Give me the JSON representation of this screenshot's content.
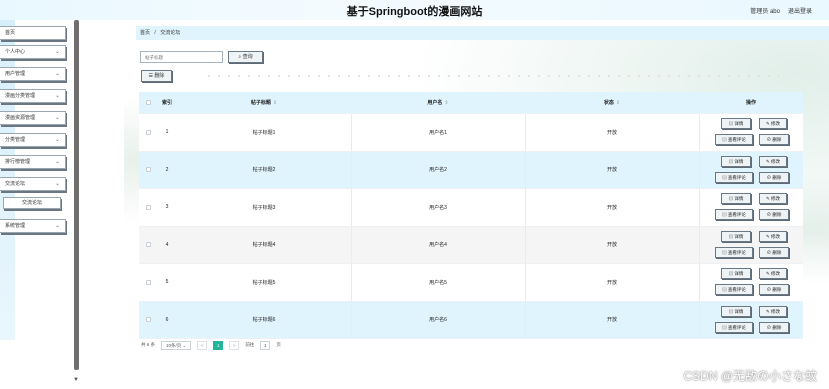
{
  "header": {
    "title": "基于Springboot的漫画网站",
    "user_label": "管理员 abo",
    "logout": "退出登录"
  },
  "sidebar": {
    "items": [
      {
        "label": "首页",
        "has_chevron": false
      },
      {
        "label": "个人中心",
        "has_chevron": true
      },
      {
        "label": "用户管理",
        "has_chevron": true
      },
      {
        "label": "漫画分类管理",
        "has_chevron": true
      },
      {
        "label": "漫画资源管理",
        "has_chevron": true
      },
      {
        "label": "分类管理",
        "has_chevron": true
      },
      {
        "label": "排行榜管理",
        "has_chevron": true
      },
      {
        "label": "交流论坛",
        "has_chevron": true
      },
      {
        "label": "交流论坛",
        "sub": true
      },
      {
        "label": "系统管理",
        "has_chevron": true
      }
    ],
    "chevron": "⌄"
  },
  "breadcrumb": {
    "home": "首页",
    "sep": "/",
    "current": "交流论坛"
  },
  "search": {
    "placeholder": "帖子标题",
    "button": "查询",
    "button_icon": "search-icon"
  },
  "toolbar": {
    "delete": "删除"
  },
  "table": {
    "headers": {
      "index": "索引",
      "title": "帖子标题",
      "user": "用户名",
      "status": "状态",
      "ops": "操作"
    },
    "rows": [
      {
        "index": "1",
        "title": "帖子标题1",
        "user": "用户名1",
        "status": "开放"
      },
      {
        "index": "2",
        "title": "帖子标题2",
        "user": "用户名2",
        "status": "开放"
      },
      {
        "index": "3",
        "title": "帖子标题3",
        "user": "用户名3",
        "status": "开放"
      },
      {
        "index": "4",
        "title": "帖子标题4",
        "user": "用户名4",
        "status": "开放"
      },
      {
        "index": "5",
        "title": "帖子标题5",
        "user": "用户名5",
        "status": "开放"
      },
      {
        "index": "6",
        "title": "帖子标题6",
        "user": "用户名6",
        "status": "开放"
      }
    ],
    "ops": {
      "detail": "详情",
      "edit": "修改",
      "comments": "查看评论",
      "delete": "删除"
    }
  },
  "pager": {
    "total": "共 6 条",
    "page_size": "10条/页",
    "prev": "<",
    "current": "1",
    "next": ">",
    "goto": "前往",
    "page_value": "1",
    "page_unit": "页"
  },
  "watermark": "CSDN @无敌の小さな蚊",
  "colors": {
    "accent": "#23b59a",
    "header_bg": "#e9f8ff",
    "row_highlight": "#dff4fc"
  }
}
